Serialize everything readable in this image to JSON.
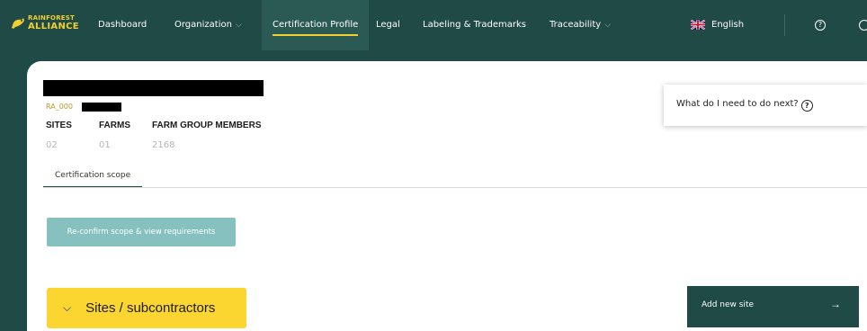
{
  "app": {
    "logo": {
      "line1": "RAINFOREST",
      "line2": "ALLIANCE"
    }
  },
  "nav": {
    "items": [
      {
        "label": "Dashboard",
        "dropdown": false
      },
      {
        "label": "Organization",
        "dropdown": true
      },
      {
        "label": "Certification Profile",
        "dropdown": false,
        "active": true
      },
      {
        "label": "Legal",
        "dropdown": false
      },
      {
        "label": "Labeling & Trademarks",
        "dropdown": false
      },
      {
        "label": "Traceability",
        "dropdown": true
      }
    ],
    "language": "English",
    "chevron": "⌵",
    "help_glyph": "?"
  },
  "profile": {
    "org_id_prefix": "RA_000",
    "stats": [
      {
        "label": "SITES",
        "value": "02"
      },
      {
        "label": "FARMS",
        "value": "01"
      },
      {
        "label": "FARM GROUP MEMBERS",
        "value": "2168"
      }
    ],
    "tab": "Certification scope",
    "reconfirm_button": "Re-confirm scope & view requirements",
    "sites_button": "Sites / subcontractors",
    "sites_chevron": "⌵",
    "next_steps": "What do I need to do next?",
    "add_site_button": "Add new site",
    "add_site_arrow": "→"
  },
  "colors": {
    "nav_bg": "#1f4a45",
    "accent_yellow": "#fbd631",
    "button_teal": "#86c1bf"
  },
  "icons": [
    "rainforest-frog-logo-icon",
    "uk-flag-icon",
    "help-icon",
    "edge-icon",
    "chevron-down-icon",
    "arrow-right-icon"
  ]
}
